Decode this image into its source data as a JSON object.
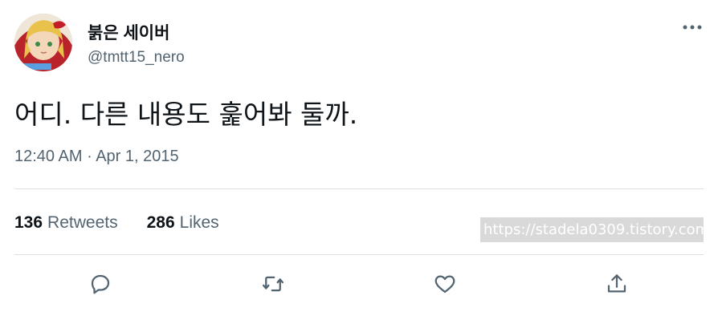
{
  "tweet": {
    "author": {
      "display_name": "붉은 세이버",
      "handle": "@tmtt15_nero"
    },
    "text": "어디. 다른 내용도 훑어봐 둘까.",
    "time": "12:40 AM",
    "separator": "·",
    "date": "Apr 1, 2015"
  },
  "stats": {
    "retweets_count": "136",
    "retweets_label": "Retweets",
    "likes_count": "286",
    "likes_label": "Likes"
  },
  "watermark": "https://stadela0309.tistory.com",
  "actions": {
    "reply_icon": "reply-icon",
    "retweet_icon": "retweet-icon",
    "like_icon": "heart-icon",
    "share_icon": "share-icon"
  },
  "colors": {
    "text_primary": "#0f1419",
    "text_secondary": "#536471",
    "divider": "#dddfe2"
  }
}
